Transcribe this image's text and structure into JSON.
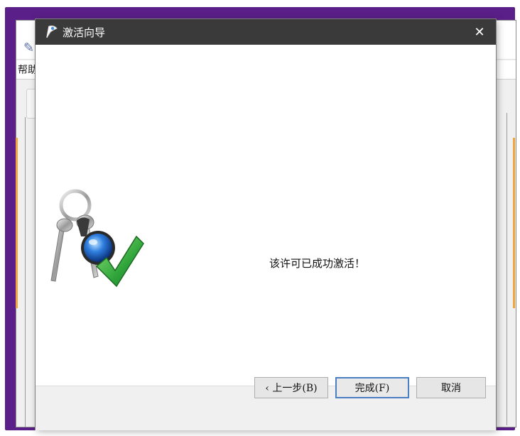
{
  "background_window": {
    "menu_label": "帮助"
  },
  "dialog": {
    "title": "激活向导",
    "close_glyph": "✕",
    "message": "该许可已成功激活！",
    "buttons": {
      "back": "‹ 上一步(B)",
      "finish": "完成(F)",
      "cancel": "取消"
    }
  },
  "colors": {
    "titlebar": "#3a3a3a",
    "frame": "#5a1f88",
    "footer": "#f0f0f0",
    "check": "#3fbf3f"
  }
}
